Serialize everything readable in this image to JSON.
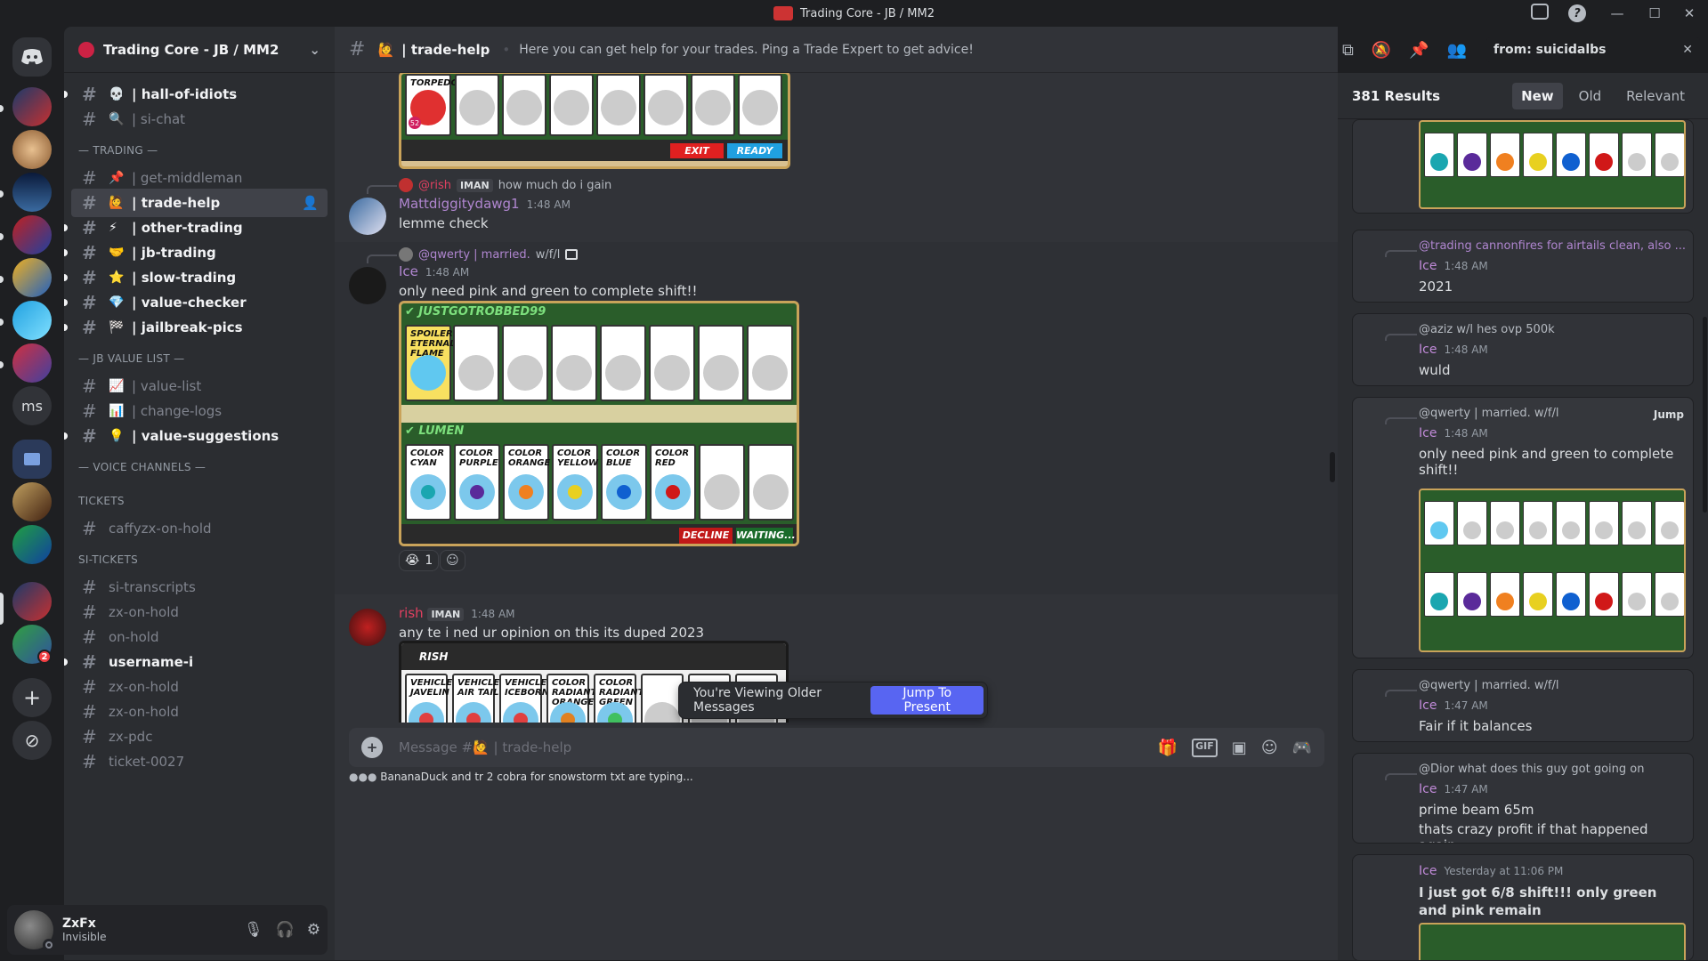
{
  "window": {
    "title": "Trading Core - JB / MM2"
  },
  "server": {
    "name": "Trading Core - JB / MM2"
  },
  "rail": {
    "ms_label": "ms",
    "badge": "2"
  },
  "channels": [
    {
      "kind": "ch",
      "emoji": "💀",
      "label": "| hall-of-idiots",
      "unread": true
    },
    {
      "kind": "ch",
      "emoji": "🔍",
      "label": "| si-chat",
      "unread": false
    },
    {
      "kind": "cat",
      "label": "— TRADING —"
    },
    {
      "kind": "ch",
      "emoji": "📌",
      "label": "| get-middleman",
      "unread": false
    },
    {
      "kind": "ch",
      "emoji": "🙋",
      "label": "| trade-help",
      "active": true
    },
    {
      "kind": "ch",
      "emoji": "⚡",
      "label": "| other-trading",
      "unread": true
    },
    {
      "kind": "ch",
      "emoji": "🤝",
      "label": "| jb-trading",
      "unread": true
    },
    {
      "kind": "ch",
      "emoji": "⭐",
      "label": "| slow-trading",
      "unread": true
    },
    {
      "kind": "ch",
      "emoji": "💎",
      "label": "| value-checker",
      "unread": true
    },
    {
      "kind": "ch",
      "emoji": "🏁",
      "label": "| jailbreak-pics",
      "unread": true
    },
    {
      "kind": "cat",
      "label": "— JB VALUE LIST —"
    },
    {
      "kind": "ch",
      "emoji": "📈",
      "label": "| value-list",
      "unread": false
    },
    {
      "kind": "ch",
      "emoji": "📊",
      "label": "| change-logs",
      "unread": false
    },
    {
      "kind": "ch",
      "emoji": "💡",
      "label": "| value-suggestions",
      "unread": true
    },
    {
      "kind": "cat",
      "label": "— VOICE CHANNELS —"
    },
    {
      "kind": "cat",
      "label": "TICKETS"
    },
    {
      "kind": "ch",
      "emoji": "",
      "label": "caffyzx-on-hold",
      "unread": false
    },
    {
      "kind": "cat",
      "label": "SI-TICKETS"
    },
    {
      "kind": "ch",
      "emoji": "",
      "label": "si-transcripts",
      "unread": false
    },
    {
      "kind": "ch",
      "emoji": "",
      "label": "zx-on-hold",
      "unread": false
    },
    {
      "kind": "ch",
      "emoji": "",
      "label": "on-hold",
      "unread": false
    },
    {
      "kind": "ch",
      "emoji": "",
      "label": "username-i",
      "unread": true
    },
    {
      "kind": "ch",
      "emoji": "",
      "label": "zx-on-hold",
      "unread": false
    },
    {
      "kind": "ch",
      "emoji": "",
      "label": "zx-on-hold",
      "unread": false
    },
    {
      "kind": "ch",
      "emoji": "",
      "label": "zx-pdc",
      "unread": false
    },
    {
      "kind": "ch",
      "emoji": "",
      "label": "ticket-0027",
      "unread": false
    }
  ],
  "user": {
    "name": "ZxFx",
    "status": "Invisible"
  },
  "channel_header": {
    "name": "| trade-help",
    "emoji": "🙋",
    "topic": "Here you can get help for your trades. Ping a Trade Expert to get advice!"
  },
  "search": {
    "query": "from: suicidalbs",
    "count": "381 Results",
    "tabs": [
      "New",
      "Old",
      "Relevant"
    ]
  },
  "messages": {
    "m1": {
      "reply_name": "@rish",
      "reply_tag": "IMAN",
      "reply_text": "how much do i gain",
      "name": "Mattdiggitydawg1",
      "time": "1:48 AM",
      "text": "lemme check"
    },
    "m2": {
      "reply_name": "@qwerty | married.",
      "reply_text": "w/f/l",
      "name": "Ice",
      "time": "1:48 AM",
      "text": "only need pink and green to complete shift!!",
      "react_count": "1"
    },
    "m3": {
      "name": "rish",
      "tag": "IMAN",
      "time": "1:48 AM",
      "text": "any te i ned ur opinion on this its duped 2023"
    }
  },
  "trade_top": {
    "item": "TORPEDO",
    "badge": "52",
    "exit": "EXIT",
    "ready": "READY"
  },
  "trade_mid": {
    "user1": "JUSTGOTROBBED99",
    "user2": "LUMEN",
    "spoiler": "SPOILER ETERNAL FLAME",
    "colors": [
      {
        "label": "COLOR CYAN",
        "hex": "#1aa6b0"
      },
      {
        "label": "COLOR PURPLE",
        "hex": "#5a2a9a"
      },
      {
        "label": "COLOR ORANGE",
        "hex": "#f08020"
      },
      {
        "label": "COLOR YELLOW",
        "hex": "#e8d020"
      },
      {
        "label": "COLOR BLUE",
        "hex": "#1060d0"
      },
      {
        "label": "COLOR RED",
        "hex": "#d01818"
      }
    ],
    "decline": "DECLINE",
    "waiting": "WAITING..."
  },
  "trade_bot": {
    "user": "RISH",
    "items": [
      "VEHICLE JAVELIN",
      "VEHICLE AIR TAIL",
      "VEHICLE ICEBORN",
      "COLOR RADIANT ORANGE",
      "COLOR RADIANT GREEN"
    ]
  },
  "toast": {
    "text": "You're Viewing Older Messages",
    "button": "Jump To Present"
  },
  "composer": {
    "placeholder": "Message #🙋 | trade-help"
  },
  "typing": {
    "text": "BananaDuck and tr 2 cobra for snowstorm txt are typing..."
  },
  "results": {
    "r1": {
      "reply": "@trading cannonfires for airtails clean, also ...",
      "name": "Ice",
      "time": "1:48 AM",
      "text": "2021"
    },
    "r2": {
      "reply": "@aziz w/l hes ovp 500k",
      "name": "Ice",
      "time": "1:48 AM",
      "text": "wuld"
    },
    "r3": {
      "reply": "@qwerty | married. w/f/l",
      "jump": "Jump",
      "name": "Ice",
      "time": "1:48 AM",
      "text": "only need pink and green to complete shift!!"
    },
    "r4": {
      "reply": "@qwerty | married. w/f/l",
      "name": "Ice",
      "time": "1:47 AM",
      "text": "Fair if it balances"
    },
    "r5": {
      "reply": "@Dior what does this guy got going on",
      "name": "Ice",
      "time": "1:47 AM",
      "text1": "prime beam 65m",
      "text2": "thats crazy profit if that happened again"
    },
    "r6": {
      "name": "Ice",
      "time": "Yesterday at 11:06 PM",
      "text": "I just got 6/8 shift!!! only green and pink remain"
    }
  }
}
